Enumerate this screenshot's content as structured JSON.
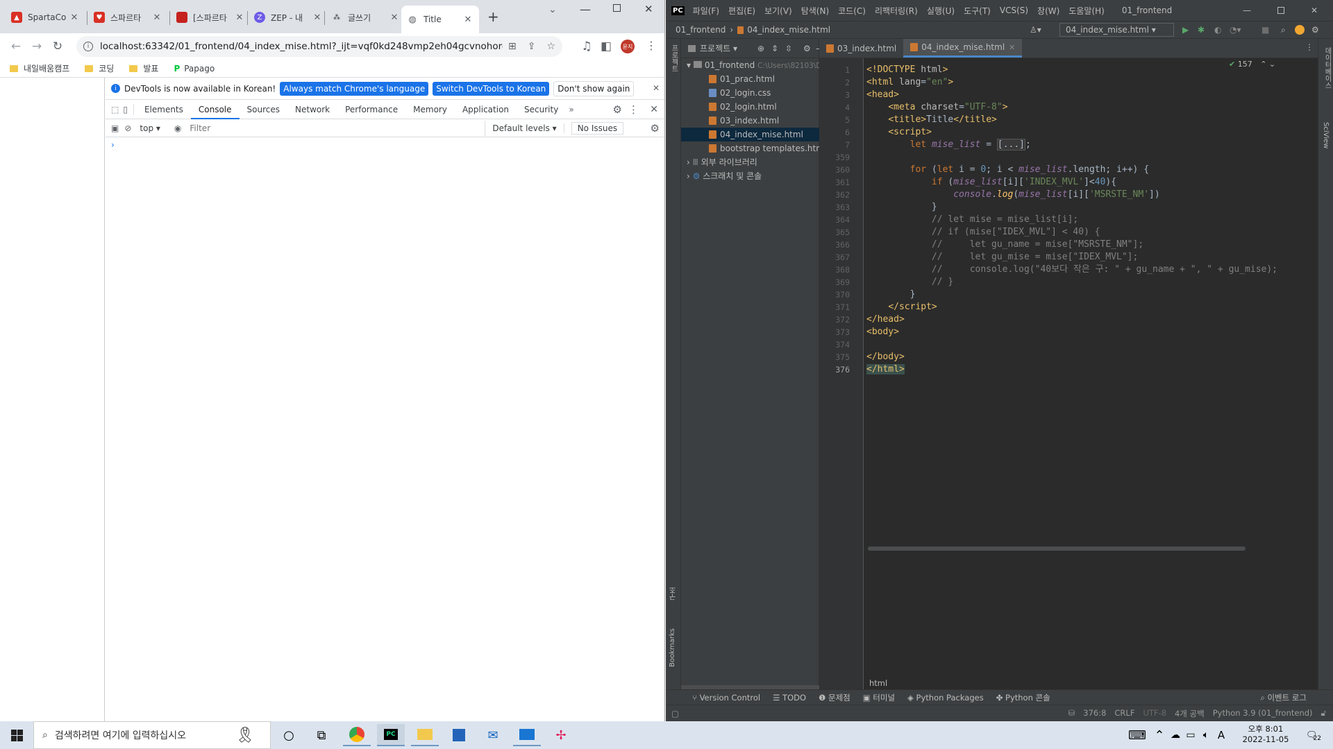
{
  "browser": {
    "tabs": [
      {
        "title": "SpartaCo",
        "color": "#d93025"
      },
      {
        "title": "스파르타",
        "color": "#d93025"
      },
      {
        "title": "[스파르타",
        "color": "#c5221f"
      },
      {
        "title": "ZEP - 내",
        "color": "#6c5ce7"
      },
      {
        "title": "글쓰기",
        "color": "#555555"
      },
      {
        "title": "Title",
        "color": "#5f6368"
      }
    ],
    "url": "localhost:63342/01_frontend/04_index_mise.html?_ijt=vqf0kd248vmp2eh04gcvnohord",
    "profile": "윤지",
    "bookmarks": [
      "내일배움캠프",
      "코딩",
      "발표",
      "Papago"
    ]
  },
  "devtools": {
    "info_text": "DevTools is now available in Korean!",
    "btn_match": "Always match Chrome's language",
    "btn_switch": "Switch DevTools to Korean",
    "btn_dont": "Don't show again",
    "tabs": [
      "Elements",
      "Console",
      "Sources",
      "Network",
      "Performance",
      "Memory",
      "Application",
      "Security"
    ],
    "context": "top",
    "filter_placeholder": "Filter",
    "levels": "Default levels",
    "issues": "No Issues",
    "prompt": "›"
  },
  "ide": {
    "menu": [
      "파일(F)",
      "편집(E)",
      "보기(V)",
      "탐색(N)",
      "코드(C)",
      "리팩터링(R)",
      "실행(U)",
      "도구(T)",
      "VCS(S)",
      "창(W)",
      "도움말(H)",
      "01_frontend"
    ],
    "nav_project": "01_frontend",
    "nav_file": "04_index_mise.html",
    "run_config": "04_index_mise.html",
    "project_label": "프로젝트",
    "tree": {
      "root": "01_frontend",
      "root_path": "C:\\Users\\82103\\Des",
      "files": [
        "01_prac.html",
        "02_login.css",
        "02_login.html",
        "03_index.html",
        "04_index_mise.html",
        "bootstrap templates.html"
      ],
      "ext_lib": "외부 라이브러리",
      "scratch": "스크래치 및 콘솔"
    },
    "editor_tabs": [
      "03_index.html",
      "04_index_mise.html"
    ],
    "inspection": "157",
    "line_numbers": [
      "1",
      "2",
      "3",
      "4",
      "5",
      "6",
      "7",
      "359",
      "360",
      "361",
      "362",
      "363",
      "364",
      "365",
      "366",
      "367",
      "368",
      "369",
      "370",
      "371",
      "372",
      "373",
      "374",
      "375",
      "376"
    ],
    "breadcrumb": "html",
    "toolwindows": [
      "Version Control",
      "TODO",
      "문제점",
      "터미널",
      "Python Packages",
      "Python 콘솔"
    ],
    "event_log": "이벤트 로그",
    "status": {
      "pos": "376:8",
      "eol": "CRLF",
      "enc": "UTF-8",
      "indent": "4개 공백",
      "interp": "Python 3.9 (01_frontend)"
    },
    "side_left": [
      "구조",
      "Bookmarks"
    ],
    "side_right": [
      "데이터베이스",
      "SciView"
    ]
  },
  "taskbar": {
    "search_placeholder": "검색하려면 여기에 입력하십시오",
    "time": "오후 8:01",
    "date": "2022-11-05",
    "ime": "A",
    "notif": "22"
  }
}
